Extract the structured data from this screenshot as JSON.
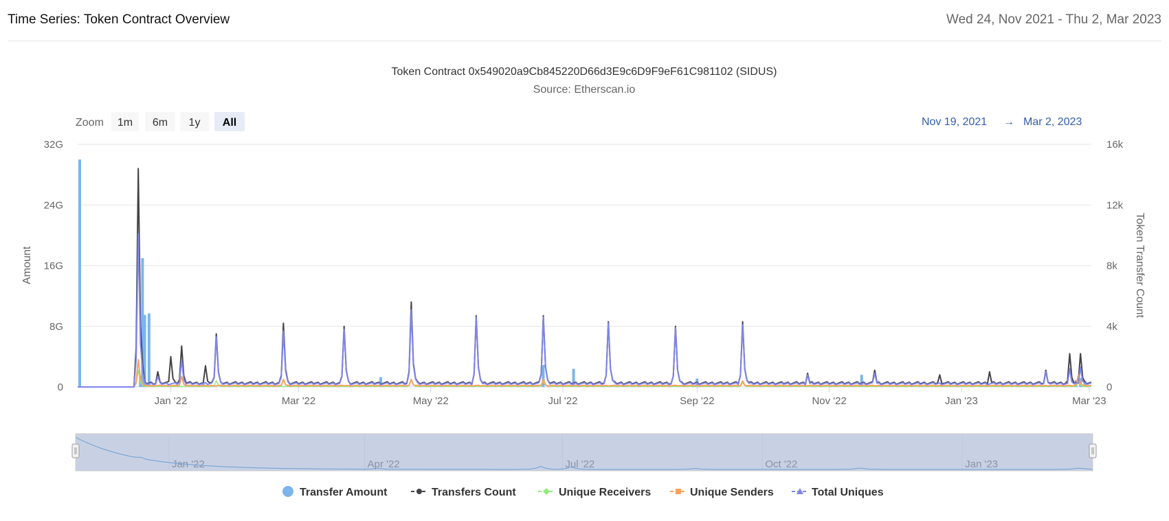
{
  "header": {
    "title": "Time Series: Token Contract Overview",
    "date_range": "Wed 24, Nov 2021 - Thu 2, Mar 2023"
  },
  "range_selector": {
    "zoom_label": "Zoom",
    "buttons": [
      {
        "label": "1m",
        "selected": false
      },
      {
        "label": "6m",
        "selected": false
      },
      {
        "label": "1y",
        "selected": false
      },
      {
        "label": "All",
        "selected": true
      }
    ],
    "from": "Nov 19, 2021",
    "arrow": "→",
    "to": "Mar 2, 2023"
  },
  "chart_data": {
    "type": "line",
    "title": "Token Contract 0x549020a9Cb845220D66d3E9c6D9F9eF61C981102 (SIDUS)",
    "subtitle": "Source: Etherscan.io",
    "x_range": [
      "2021-11-19",
      "2023-03-02"
    ],
    "x_ticks": [
      {
        "label": "Jan '22",
        "date": "2022-01-01"
      },
      {
        "label": "Mar '22",
        "date": "2022-03-01"
      },
      {
        "label": "May '22",
        "date": "2022-05-01"
      },
      {
        "label": "Jul '22",
        "date": "2022-07-01"
      },
      {
        "label": "Sep '22",
        "date": "2022-09-01"
      },
      {
        "label": "Nov '22",
        "date": "2022-11-01"
      },
      {
        "label": "Jan '23",
        "date": "2023-01-01"
      },
      {
        "label": "Mar '23",
        "date": "2023-03-01"
      }
    ],
    "y_left": {
      "label": "Amount",
      "min": 0,
      "max": 32000000000,
      "ticks": [
        "0",
        "8G",
        "16G",
        "24G",
        "32G"
      ]
    },
    "y_right": {
      "label": "Token Transfer Count",
      "min": 0,
      "max": 16000,
      "ticks": [
        "0",
        "4k",
        "8k",
        "12k",
        "16k"
      ]
    },
    "grid": true,
    "legend_position": "bottom",
    "colors": {
      "transfer_amount": "#7cb5ec",
      "transfers_count": "#434348",
      "unique_receivers": "#90ed7d",
      "unique_senders": "#f7a35c",
      "total_uniques": "#8085e9"
    },
    "amount_series": {
      "name": "Transfer Amount",
      "axis": "left",
      "type": "column",
      "points": [
        {
          "date": "2021-11-19",
          "value": 30000000000
        },
        {
          "date": "2021-12-17",
          "value": 1500000000
        },
        {
          "date": "2021-12-18",
          "value": 17000000000
        },
        {
          "date": "2021-12-19",
          "value": 9500000000
        },
        {
          "date": "2021-12-21",
          "value": 9700000000
        },
        {
          "date": "2022-01-15",
          "value": 500000000
        },
        {
          "date": "2022-04-07",
          "value": 1300000000
        },
        {
          "date": "2022-06-21",
          "value": 2900000000
        },
        {
          "date": "2022-07-05",
          "value": 2400000000
        },
        {
          "date": "2022-08-31",
          "value": 1100000000
        },
        {
          "date": "2022-11-15",
          "value": 1600000000
        },
        {
          "date": "2023-02-22",
          "value": 900000000
        },
        {
          "date": "2023-02-24",
          "value": 1200000000
        },
        {
          "date": "2023-02-26",
          "value": 800000000
        }
      ]
    },
    "count_series": [
      {
        "name": "Transfers Count",
        "axis": "right",
        "peaks": [
          {
            "date": "2021-12-17",
            "value": 14400
          },
          {
            "date": "2021-12-26",
            "value": 1000
          },
          {
            "date": "2022-01-01",
            "value": 2000
          },
          {
            "date": "2022-01-06",
            "value": 2700
          },
          {
            "date": "2022-01-17",
            "value": 1400
          },
          {
            "date": "2022-01-22",
            "value": 3500
          },
          {
            "date": "2022-02-22",
            "value": 4200
          },
          {
            "date": "2022-03-22",
            "value": 4000
          },
          {
            "date": "2022-04-22",
            "value": 5600
          },
          {
            "date": "2022-05-22",
            "value": 4700
          },
          {
            "date": "2022-06-22",
            "value": 4700
          },
          {
            "date": "2022-07-22",
            "value": 4300
          },
          {
            "date": "2022-08-22",
            "value": 4000
          },
          {
            "date": "2022-09-22",
            "value": 4300
          },
          {
            "date": "2022-10-22",
            "value": 900
          },
          {
            "date": "2022-11-22",
            "value": 1100
          },
          {
            "date": "2022-12-22",
            "value": 800
          },
          {
            "date": "2023-01-14",
            "value": 1000
          },
          {
            "date": "2023-02-09",
            "value": 1100
          },
          {
            "date": "2023-02-20",
            "value": 2200
          },
          {
            "date": "2023-02-25",
            "value": 2200
          }
        ]
      },
      {
        "name": "Unique Receivers",
        "axis": "right",
        "peaks": [
          {
            "date": "2021-12-17",
            "value": 1100
          },
          {
            "date": "2022-01-22",
            "value": 400
          },
          {
            "date": "2022-04-22",
            "value": 500
          },
          {
            "date": "2022-06-22",
            "value": 400
          },
          {
            "date": "2022-09-22",
            "value": 300
          },
          {
            "date": "2023-02-24",
            "value": 400
          }
        ]
      },
      {
        "name": "Unique Senders",
        "axis": "right",
        "peaks": [
          {
            "date": "2021-12-17",
            "value": 1800
          },
          {
            "date": "2022-01-06",
            "value": 700
          },
          {
            "date": "2022-02-22",
            "value": 500
          },
          {
            "date": "2022-04-22",
            "value": 500
          },
          {
            "date": "2022-06-22",
            "value": 500
          },
          {
            "date": "2022-09-22",
            "value": 400
          },
          {
            "date": "2023-02-24",
            "value": 800
          }
        ]
      },
      {
        "name": "Total Uniques",
        "axis": "right",
        "peaks": [
          {
            "date": "2021-12-17",
            "value": 10100
          },
          {
            "date": "2021-12-26",
            "value": 700
          },
          {
            "date": "2022-01-06",
            "value": 1800
          },
          {
            "date": "2022-01-22",
            "value": 3300
          },
          {
            "date": "2022-02-22",
            "value": 3700
          },
          {
            "date": "2022-03-22",
            "value": 3800
          },
          {
            "date": "2022-04-22",
            "value": 5100
          },
          {
            "date": "2022-05-22",
            "value": 4600
          },
          {
            "date": "2022-06-22",
            "value": 4600
          },
          {
            "date": "2022-07-22",
            "value": 4200
          },
          {
            "date": "2022-08-22",
            "value": 3900
          },
          {
            "date": "2022-09-22",
            "value": 4100
          },
          {
            "date": "2022-10-22",
            "value": 800
          },
          {
            "date": "2022-11-22",
            "value": 900
          },
          {
            "date": "2023-02-09",
            "value": 1000
          },
          {
            "date": "2023-02-20",
            "value": 1200
          },
          {
            "date": "2023-02-25",
            "value": 1300
          }
        ]
      }
    ],
    "navigator": {
      "ticks": [
        {
          "label": "Jan '22",
          "date": "2022-01-01"
        },
        {
          "label": "Apr '22",
          "date": "2022-04-01"
        },
        {
          "label": "Jul '22",
          "date": "2022-07-01"
        },
        {
          "label": "Oct '22",
          "date": "2022-10-01"
        },
        {
          "label": "Jan '23",
          "date": "2023-01-01"
        }
      ]
    },
    "legend": [
      {
        "name": "Transfer Amount",
        "color": "#7cb5ec",
        "symbol": "circle"
      },
      {
        "name": "Transfers Count",
        "color": "#434348",
        "symbol": "circle"
      },
      {
        "name": "Unique Receivers",
        "color": "#90ed7d",
        "symbol": "diamond"
      },
      {
        "name": "Unique Senders",
        "color": "#f7a35c",
        "symbol": "square"
      },
      {
        "name": "Total Uniques",
        "color": "#8085e9",
        "symbol": "triangle"
      }
    ]
  }
}
